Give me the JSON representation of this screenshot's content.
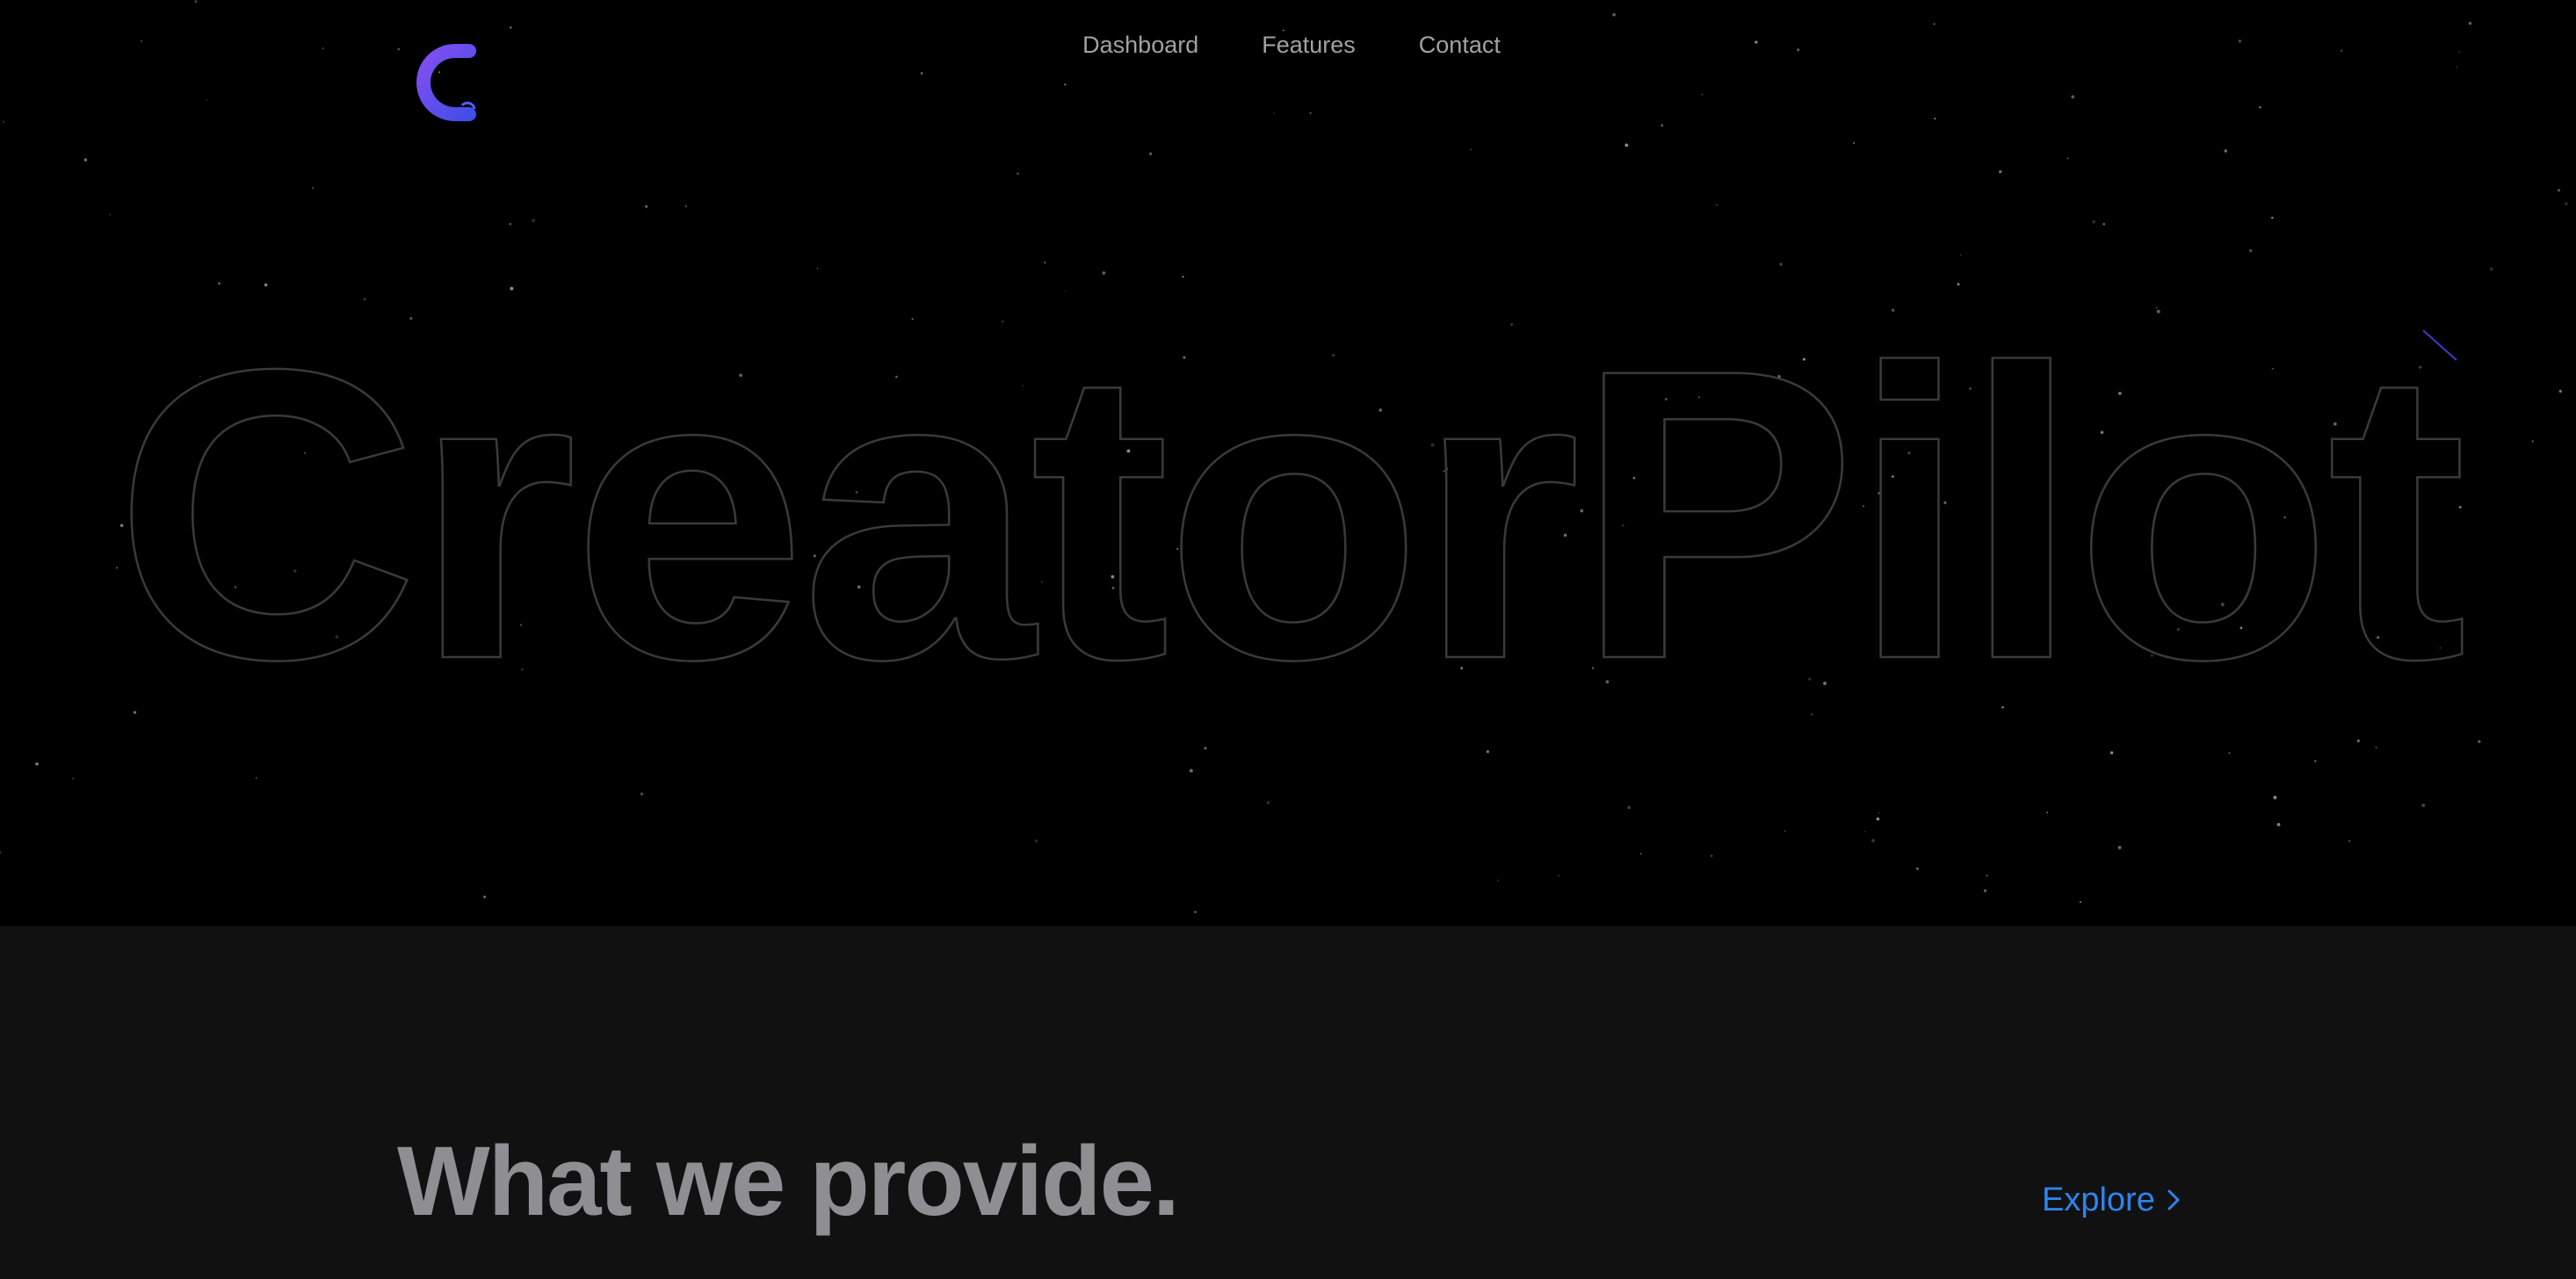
{
  "brand": {
    "logo_icon": "c-logo-icon",
    "gradient_start": "#7b4df0",
    "gradient_end": "#3b4ee6",
    "wordmark": "CreatorPilot"
  },
  "nav": {
    "items": [
      {
        "label": "Dashboard"
      },
      {
        "label": "Features"
      },
      {
        "label": "Contact"
      }
    ]
  },
  "provide": {
    "title": "What we provide.",
    "explore_label": "Explore",
    "explore_icon": "chevron-right-icon",
    "link_color": "#2d84f0"
  },
  "colors": {
    "hero_bg": "#000000",
    "section_bg": "#111111",
    "nav_text": "#a1a1a6",
    "wordmark_stroke": "#3a3a3c"
  }
}
